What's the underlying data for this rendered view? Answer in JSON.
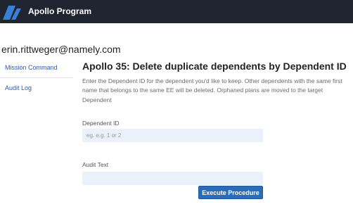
{
  "app": {
    "title": "Apollo Program",
    "logo_icon": "apollo-logo-icon"
  },
  "user": {
    "email": "erin.rittweger@namely.com"
  },
  "sidebar": {
    "items": [
      {
        "label": "Mission Command"
      },
      {
        "label": "Audit Log"
      }
    ]
  },
  "main": {
    "title": "Apollo 35: Delete duplicate dependents by Dependent ID",
    "description": "Enter the Dependent ID for the dependent you'd like to keep. Other dependents with the same first name that belongs to the same EE will be deleted. Orphaned plans are moved to the target Dependent",
    "dependent_id": {
      "label": "Dependent ID",
      "placeholder": "eg. e.g. 1 or 2",
      "value": ""
    },
    "audit_text": {
      "label": "Audit Text",
      "value": ""
    },
    "execute_label": "Execute Procedure"
  },
  "colors": {
    "topbar": "#1f2530",
    "accent": "#2b6cb8",
    "logo": "#3b7fd4",
    "link": "#2a5aa8",
    "input_bg": "#eaf1fb"
  }
}
